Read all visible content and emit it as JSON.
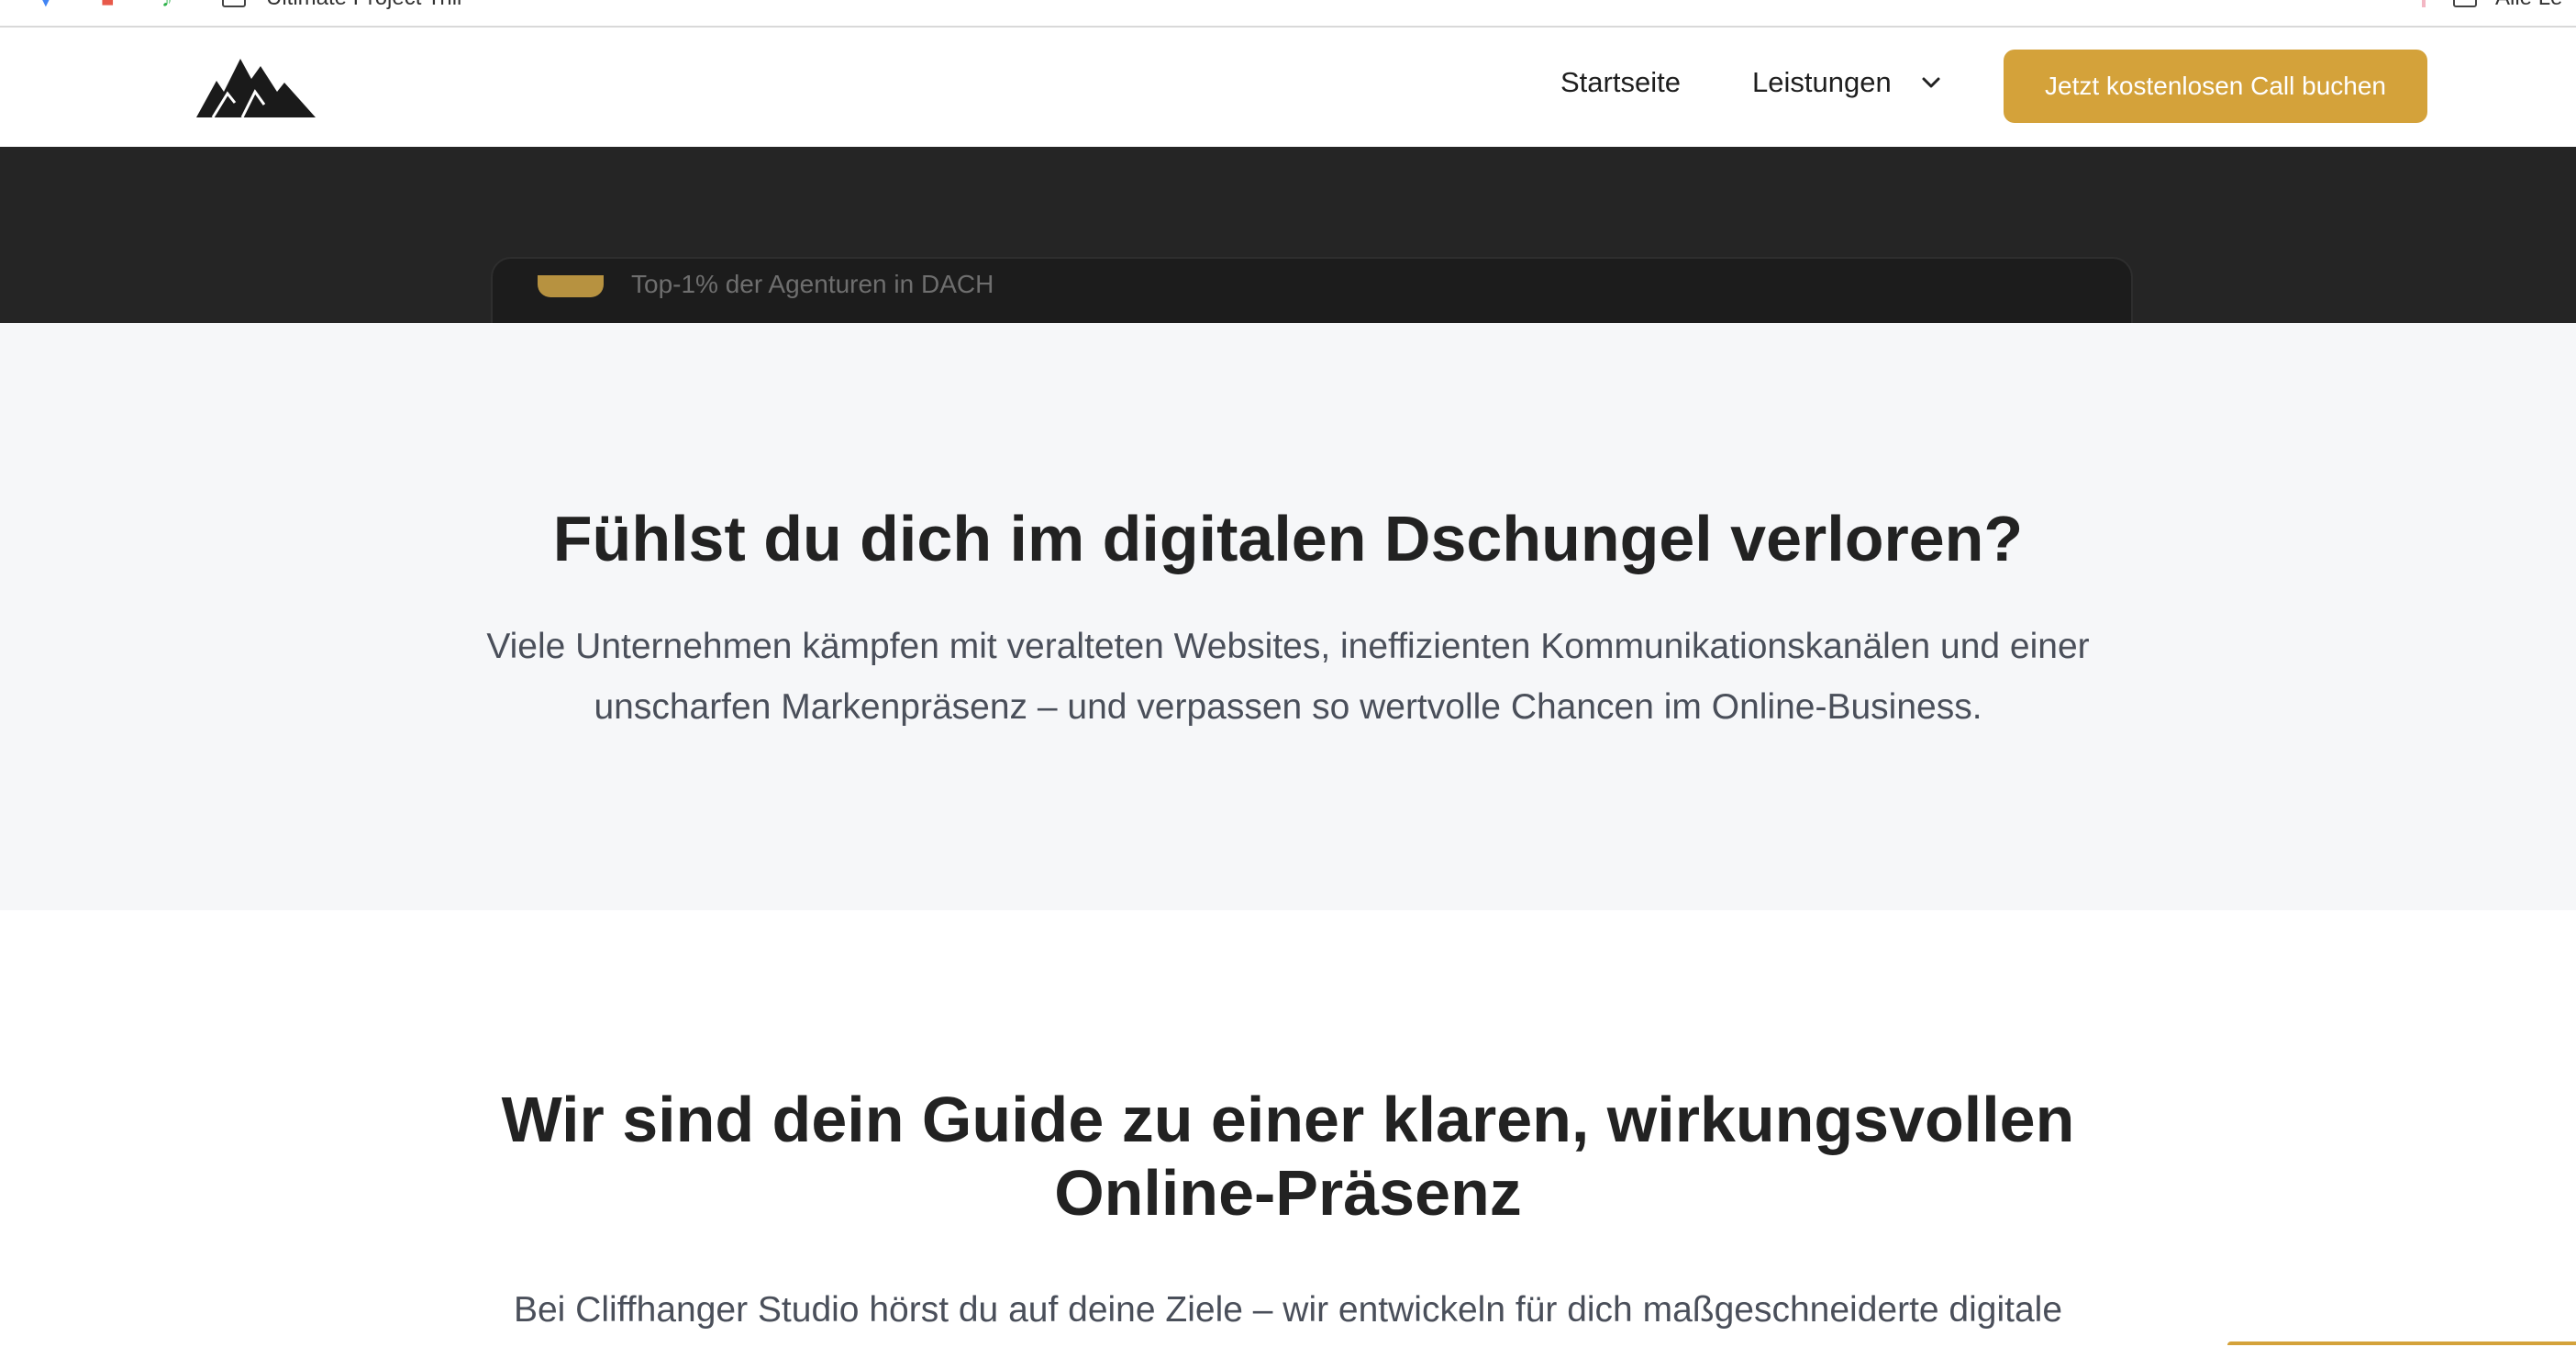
{
  "browser": {
    "bookmark_folder_label": "Ultimate Project Trill",
    "bookmark_right_label": "Alle Le"
  },
  "nav": {
    "home_label": "Startseite",
    "services_label": "Leistungen",
    "cta_label": "Jetzt kostenlosen Call buchen",
    "accent_color": "#d4a23a"
  },
  "hero": {
    "card_text": "Top-1% der Agenturen in DACH"
  },
  "problem": {
    "title": "Fühlst du dich im digitalen Dschungel verloren?",
    "text_line1": "Viele Unternehmen kämpfen mit veralteten Websites, ineffizienten Kommunikationskanälen und einer",
    "text_line2": "unscharfen Markenpräsenz – und verpassen so wertvolle Chancen im Online-Business."
  },
  "guide": {
    "title_line1": "Wir sind dein Guide zu einer klaren, wirkungsvollen",
    "title_line2": "Online-Präsenz",
    "text_line1": "Bei Cliffhanger Studio hörst du auf deine Ziele – wir entwickeln für dich maßgeschneiderte digitale"
  },
  "icons": [
    "mountain-logo-icon",
    "chevron-down-icon",
    "folder-icon"
  ]
}
